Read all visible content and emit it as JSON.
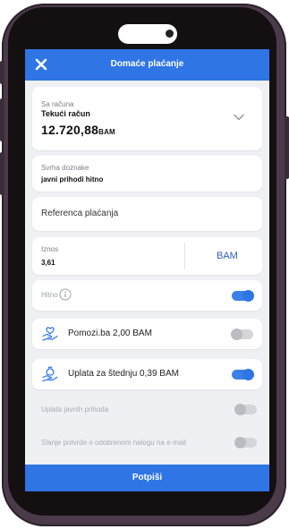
{
  "header": {
    "title": "Domaće plaćanje"
  },
  "account": {
    "label": "Sa računa",
    "name": "Tekući račun",
    "balance": "12.720,88",
    "currency": "BAM"
  },
  "purpose": {
    "label": "Svrha doznake",
    "value": "javni prihodi hitno"
  },
  "reference": {
    "placeholder": "Referenca plaćanja"
  },
  "amount": {
    "label": "Iznos",
    "value": "3,61",
    "currency": "BAM"
  },
  "urgent": {
    "label": "Hitno",
    "enabled": true
  },
  "donation": {
    "label": "Pomozi.ba 2,00 BAM",
    "enabled": false,
    "icon": "heart-hand-icon"
  },
  "savings": {
    "label": "Uplata za štednju 0,39 BAM",
    "enabled": true,
    "icon": "money-bag-hand-icon"
  },
  "public_revenue": {
    "label": "Uplata javnih prihoda",
    "enabled": false
  },
  "email_confirmation": {
    "label": "Slanje potvrde o odobrenom nalogu na e-mail",
    "enabled": false
  },
  "actions": {
    "sign_label": "Potpiši"
  },
  "colors": {
    "accent": "#2f75e6",
    "background": "#eef0f4",
    "toggle_off": "#d3d5d9"
  }
}
